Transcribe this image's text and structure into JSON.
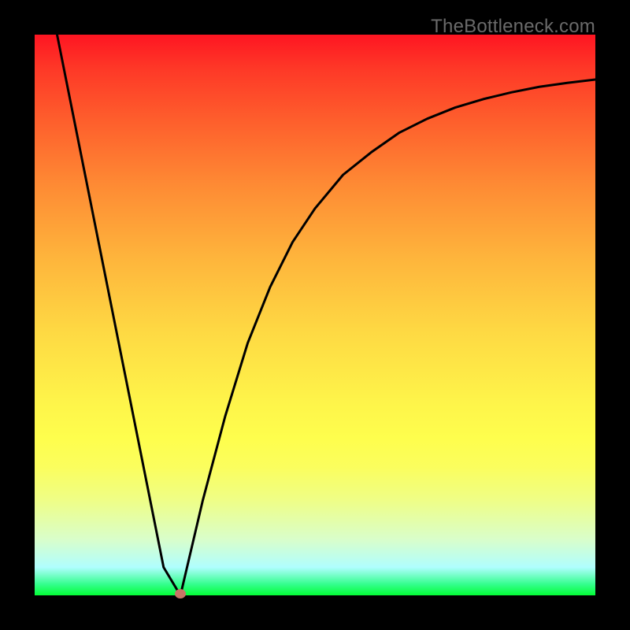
{
  "watermark": "TheBottleneck.com",
  "colors": {
    "frame": "#000000",
    "curve": "#000000",
    "marker": "#c77466",
    "gradient_top": "#fe1522",
    "gradient_bottom": "#03fe37"
  },
  "chart_data": {
    "type": "line",
    "title": "",
    "xlabel": "",
    "ylabel": "",
    "xlim": [
      0,
      100
    ],
    "ylim": [
      0,
      100
    ],
    "legend": false,
    "grid": false,
    "annotations": [
      {
        "text": "TheBottleneck.com",
        "position": "top-right"
      }
    ],
    "series": [
      {
        "name": "bottleneck-curve",
        "x": [
          4,
          8,
          12,
          16,
          20,
          23,
          26,
          30,
          34,
          38,
          42,
          46,
          50,
          55,
          60,
          65,
          70,
          75,
          80,
          85,
          90,
          95,
          100
        ],
        "y": [
          100,
          80,
          60,
          40,
          20,
          5,
          0,
          17,
          32,
          45,
          55,
          63,
          69,
          75,
          79,
          82.5,
          85,
          87,
          88.5,
          89.7,
          90.7,
          91.4,
          92
        ]
      }
    ],
    "marker": {
      "x": 26,
      "y": 0
    },
    "notes": "x and y are percentages of the plot extent. y=0 is the bottom (green) edge, y=100 is the top (red) edge. Curve is a V-shaped bottleneck profile with minimum near x≈26."
  }
}
